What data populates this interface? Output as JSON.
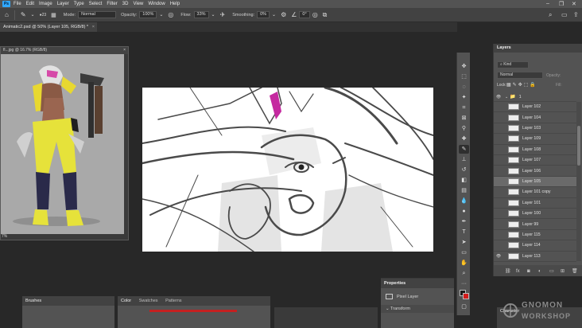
{
  "menu": {
    "logo": "Ps",
    "items": [
      "File",
      "Edit",
      "Image",
      "Layer",
      "Type",
      "Select",
      "Filter",
      "3D",
      "View",
      "Window",
      "Help"
    ]
  },
  "options": {
    "brush_size": "23",
    "mode_label": "Mode:",
    "mode_value": "Normal",
    "opacity_label": "Opacity:",
    "opacity_value": "100%",
    "flow_label": "Flow:",
    "flow_value": "33%",
    "smoothing_label": "Smoothing:",
    "smoothing_value": "0%",
    "angle_value": "0°"
  },
  "document": {
    "tab_title": "Animatic2.psd @ 50% (Layer 105, RGB/8) *",
    "tab_close": "×"
  },
  "reference": {
    "title": "fl...jpg @ 16.7% (RGB/8)",
    "zoom": "7%",
    "close": "×"
  },
  "layers": {
    "panel_title": "Layers",
    "filter_label": "Kind",
    "blend_mode": "Normal",
    "opacity_label": "Opacity:",
    "lock_label": "Lock:",
    "fill_label": "Fill:",
    "group_name": "1",
    "items": [
      {
        "name": "Layer 102",
        "visible": false,
        "selected": false
      },
      {
        "name": "Layer 104",
        "visible": false,
        "selected": false
      },
      {
        "name": "Layer 103",
        "visible": false,
        "selected": false
      },
      {
        "name": "Layer 109",
        "visible": false,
        "selected": false
      },
      {
        "name": "Layer 108",
        "visible": false,
        "selected": false
      },
      {
        "name": "Layer 107",
        "visible": false,
        "selected": false
      },
      {
        "name": "Layer 106",
        "visible": false,
        "selected": false
      },
      {
        "name": "Layer 105",
        "visible": false,
        "selected": true
      },
      {
        "name": "Layer 101 copy",
        "visible": false,
        "selected": false
      },
      {
        "name": "Layer 101",
        "visible": false,
        "selected": false
      },
      {
        "name": "Layer 100",
        "visible": false,
        "selected": false
      },
      {
        "name": "Layer 99",
        "visible": false,
        "selected": false
      },
      {
        "name": "Layer 115",
        "visible": false,
        "selected": false
      },
      {
        "name": "Layer 114",
        "visible": false,
        "selected": false
      },
      {
        "name": "Layer 113",
        "visible": true,
        "selected": false
      }
    ],
    "footer_icons": [
      "link-icon",
      "fx-icon",
      "mask-icon",
      "adjustment-icon",
      "folder-icon",
      "new-layer-icon",
      "trash-icon"
    ]
  },
  "properties": {
    "title": "Properties",
    "kind": "Pixel Layer",
    "section": "Transform"
  },
  "bottom": {
    "brushes_title": "Brushes",
    "color_tabs": [
      "Color",
      "Swatches",
      "Patterns"
    ],
    "character_title": "Character"
  },
  "watermark": {
    "line1": "GNOMON",
    "line2": "WORKSHOP"
  },
  "colors": {
    "foreground": "#1a1a1a",
    "background": "#d11a1a",
    "accent": "#31a8ff"
  }
}
